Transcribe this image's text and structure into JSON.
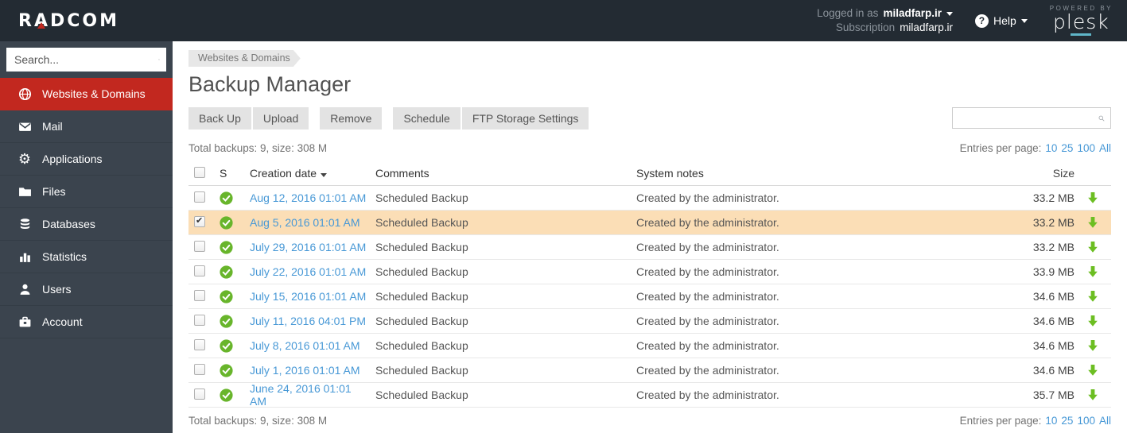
{
  "colors": {
    "topbar": "#232b33",
    "sidebar": "#3b444e",
    "accent": "#c2281f",
    "link": "#4798d6",
    "status_green": "#68b52b",
    "download_green": "#6cbe22",
    "selected_row": "#fbdeb6"
  },
  "topbar": {
    "logo": "RADCOM",
    "logged_in_label": "Logged in as",
    "user": "miladfarp.ir",
    "subscription_label": "Subscription",
    "subscription_value": "miladfarp.ir",
    "help_label": "Help",
    "powered_by": "POWERED BY",
    "plesk": "plesk"
  },
  "sidebar": {
    "search_placeholder": "Search...",
    "items": [
      {
        "label": "Websites & Domains",
        "icon": "globe-icon",
        "active": true
      },
      {
        "label": "Mail",
        "icon": "mail-icon",
        "active": false
      },
      {
        "label": "Applications",
        "icon": "gear-icon",
        "active": false
      },
      {
        "label": "Files",
        "icon": "folder-icon",
        "active": false
      },
      {
        "label": "Databases",
        "icon": "database-icon",
        "active": false
      },
      {
        "label": "Statistics",
        "icon": "bar-chart-icon",
        "active": false
      },
      {
        "label": "Users",
        "icon": "user-icon",
        "active": false
      },
      {
        "label": "Account",
        "icon": "briefcase-icon",
        "active": false
      }
    ]
  },
  "main": {
    "breadcrumb": "Websites & Domains",
    "title": "Backup Manager",
    "toolbar_groups": [
      [
        "Back Up",
        "Upload"
      ],
      [
        "Remove"
      ],
      [
        "Schedule",
        "FTP Storage Settings"
      ]
    ],
    "list_search_value": "",
    "summary_top": "Total backups: 9, size: 308 M",
    "summary_bottom": "Total backups: 9, size: 308 M",
    "entries_label": "Entries per page:",
    "entries_options": [
      "10",
      "25",
      "100",
      "All"
    ],
    "table": {
      "headers": {
        "status": "S",
        "creation_date": "Creation date",
        "comments": "Comments",
        "system_notes": "System notes",
        "size": "Size"
      },
      "rows": [
        {
          "date": "Aug 12, 2016 01:01 AM",
          "comment": "Scheduled Backup",
          "note": "Created by the administrator.",
          "size": "33.2 MB",
          "selected": false
        },
        {
          "date": "Aug 5, 2016 01:01 AM",
          "comment": "Scheduled Backup",
          "note": "Created by the administrator.",
          "size": "33.2 MB",
          "selected": true
        },
        {
          "date": "July 29, 2016 01:01 AM",
          "comment": "Scheduled Backup",
          "note": "Created by the administrator.",
          "size": "33.2 MB",
          "selected": false
        },
        {
          "date": "July 22, 2016 01:01 AM",
          "comment": "Scheduled Backup",
          "note": "Created by the administrator.",
          "size": "33.9 MB",
          "selected": false
        },
        {
          "date": "July 15, 2016 01:01 AM",
          "comment": "Scheduled Backup",
          "note": "Created by the administrator.",
          "size": "34.6 MB",
          "selected": false
        },
        {
          "date": "July 11, 2016 04:01 PM",
          "comment": "Scheduled Backup",
          "note": "Created by the administrator.",
          "size": "34.6 MB",
          "selected": false
        },
        {
          "date": "July 8, 2016 01:01 AM",
          "comment": "Scheduled Backup",
          "note": "Created by the administrator.",
          "size": "34.6 MB",
          "selected": false
        },
        {
          "date": "July 1, 2016 01:01 AM",
          "comment": "Scheduled Backup",
          "note": "Created by the administrator.",
          "size": "34.6 MB",
          "selected": false
        },
        {
          "date": "June 24, 2016 01:01 AM",
          "comment": "Scheduled Backup",
          "note": "Created by the administrator.",
          "size": "35.7 MB",
          "selected": false
        }
      ]
    }
  }
}
